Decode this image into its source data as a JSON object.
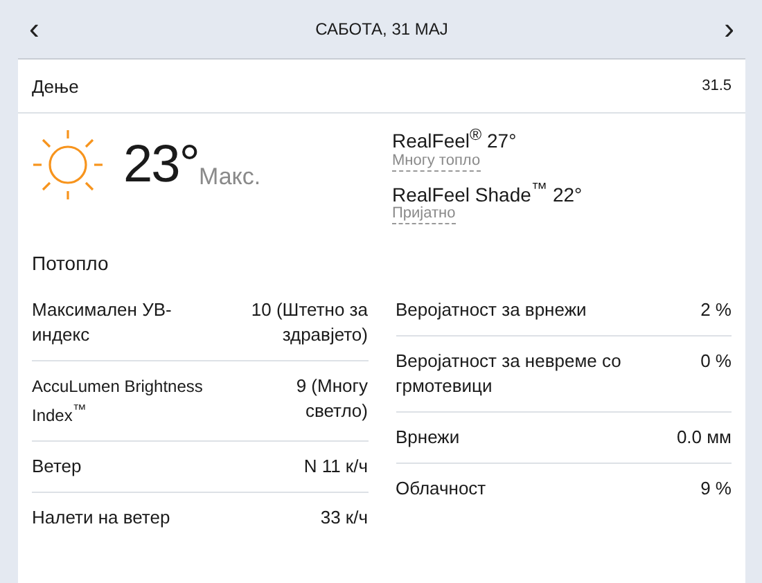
{
  "header": {
    "title": "САБОТА, 31 МАЈ",
    "prev": "‹",
    "next": "›"
  },
  "card": {
    "label": "Дење",
    "date": "31.5",
    "temperature": "23°",
    "temperature_label": "Макс.",
    "realfeel": [
      {
        "text": "RealFeel$^{®}$ 27°",
        "note": "Многу топло"
      },
      {
        "text": "RealFeel Shade$^{™}$ 22°",
        "note": "Пријатно"
      }
    ],
    "phrase": "Потопло",
    "left": [
      {
        "label": "Максимален УВ-индекс",
        "value": "10 (Штетно за здравјето)"
      },
      {
        "label": "AccuLumen Brightness Index$^{™}$",
        "value": "9 (Многу светло)"
      },
      {
        "label": "Ветер",
        "value": "N 11 к/ч"
      },
      {
        "label": "Налети на ветер",
        "value": "33 к/ч"
      }
    ],
    "right": [
      {
        "label": "Веројатност за врнежи",
        "value": "2 %"
      },
      {
        "label": "Веројатност за невреме со грмотевици",
        "value": "0 %"
      },
      {
        "label": "Врнежи",
        "value": "0.0 мм"
      },
      {
        "label": "Облачност",
        "value": "9 %"
      }
    ]
  }
}
